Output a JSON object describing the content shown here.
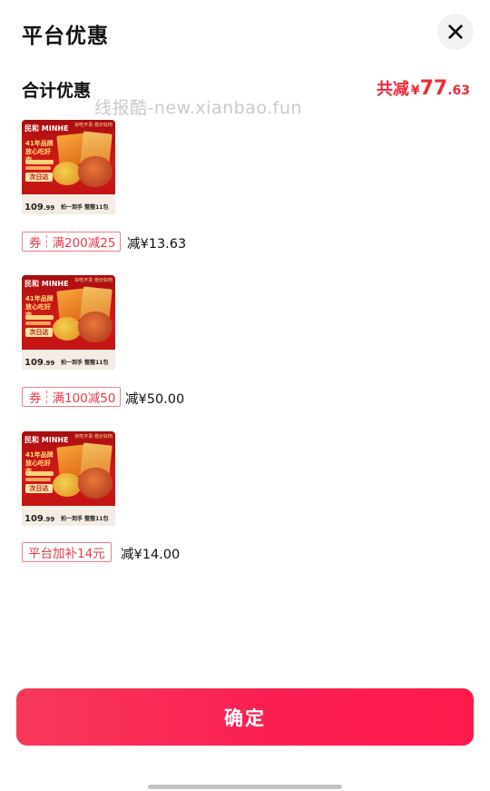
{
  "header": {
    "title": "平台优惠"
  },
  "summary": {
    "label": "合计优惠",
    "total_prefix": "共减",
    "currency": "¥",
    "total_int": "77",
    "total_dec": ".63"
  },
  "watermark": "线报酷-new.xianbao.fun",
  "items": [
    {
      "product": {
        "brand": "民和 MINHE",
        "corner": "好吃不贵 低价好肉",
        "headline": "41年品牌 放心吃好肉",
        "next_day": "次日达",
        "price_int": "109",
        "price_dec": ".99",
        "slogan": "拍一到手 整整11包"
      },
      "discount": {
        "type": "券",
        "value": "满200减25",
        "saving": "减¥13.63"
      }
    },
    {
      "product": {
        "brand": "民和 MINHE",
        "corner": "好吃不贵 低价好肉",
        "headline": "41年品牌 放心吃好肉",
        "next_day": "次日达",
        "price_int": "109",
        "price_dec": ".99",
        "slogan": "拍一到手 整整11包"
      },
      "discount": {
        "type": "券",
        "value": "满100减50",
        "saving": "减¥50.00"
      }
    },
    {
      "product": {
        "brand": "民和 MINHE",
        "corner": "好吃不贵 低价好肉",
        "headline": "41年品牌 放心吃好肉",
        "next_day": "次日达",
        "price_int": "109",
        "price_dec": ".99",
        "slogan": "拍一到手 整整11包"
      },
      "discount": {
        "value": "平台加补14元",
        "saving": "减¥14.00"
      }
    }
  ],
  "confirm": {
    "label": "确定"
  },
  "colors": {
    "accent": "#ee2a3b",
    "button": "#fb1f51",
    "tag_border": "#f07e86"
  }
}
